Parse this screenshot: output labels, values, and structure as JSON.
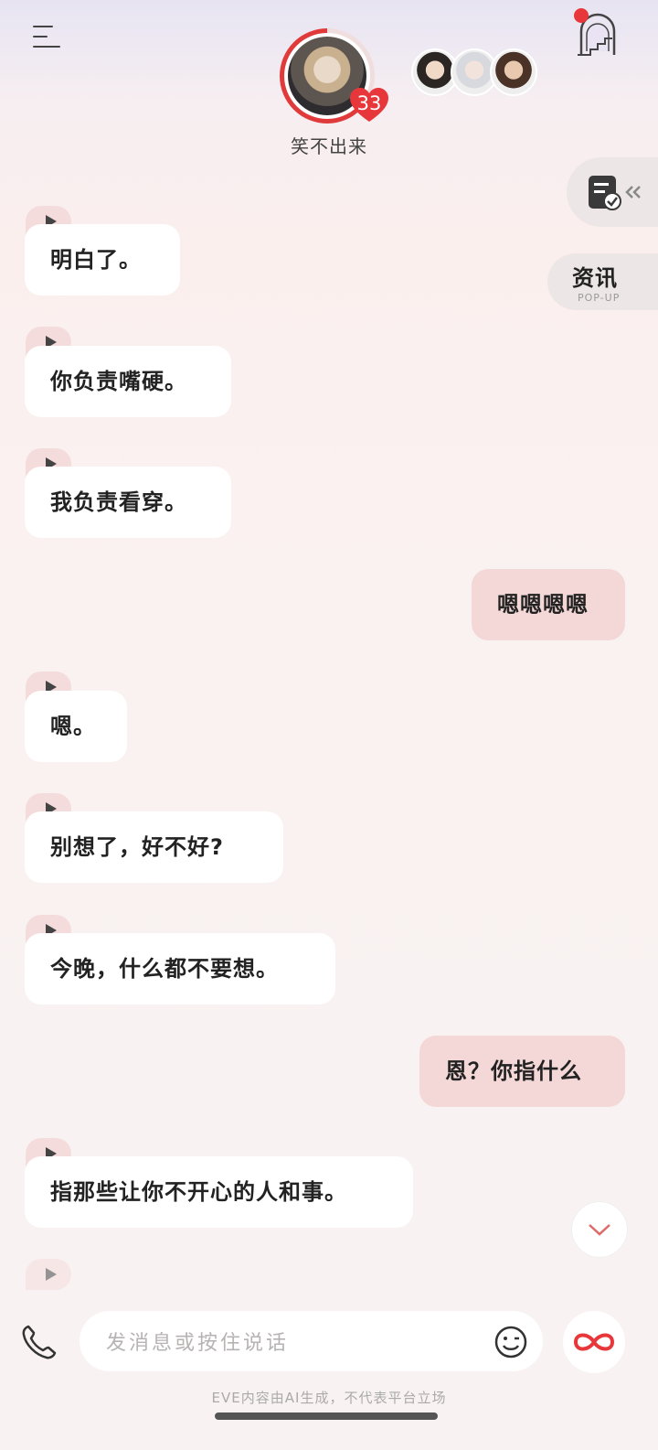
{
  "header": {
    "character_name": "笑不出来",
    "affection_level": "33",
    "affection_ratio": 0.65,
    "colors": {
      "accent": "#e03a3a",
      "ring_track": "#f0dede"
    }
  },
  "side": {
    "news_title": "资讯",
    "news_sub": "POP-UP"
  },
  "messages": [
    {
      "from": "ai",
      "text": "明白了。"
    },
    {
      "from": "ai",
      "text": "你负责嘴硬。"
    },
    {
      "from": "ai",
      "text": "我负责看穿。"
    },
    {
      "from": "user",
      "text": "嗯嗯嗯嗯"
    },
    {
      "from": "ai",
      "text": "嗯。"
    },
    {
      "from": "ai",
      "text": "别想了，好不好?"
    },
    {
      "from": "ai",
      "text": "今晚，什么都不要想。"
    },
    {
      "from": "user",
      "text": "恩？你指什么"
    },
    {
      "from": "ai",
      "text": "指那些让你不开心的人和事。"
    }
  ],
  "input": {
    "placeholder": "发消息或按住说话"
  },
  "footer": {
    "disclaimer": "EVE内容由AI生成，不代表平台立场"
  },
  "icons": [
    "menu-icon",
    "stairs-icon",
    "document-check-icon",
    "phone-icon",
    "emoji-icon",
    "infinity-icon",
    "chevron-down-icon",
    "play-icon"
  ]
}
